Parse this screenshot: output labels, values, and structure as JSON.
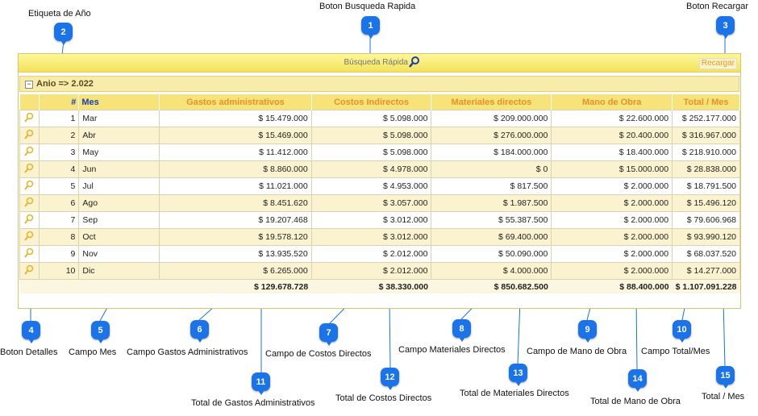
{
  "annotations": {
    "n1": {
      "num": "1",
      "label": "Boton Busqueda Rapida"
    },
    "n2": {
      "num": "2",
      "label": "Etiqueta de Año"
    },
    "n3": {
      "num": "3",
      "label": "Boton Recargar"
    },
    "n4": {
      "num": "4",
      "label": "Boton Detalles"
    },
    "n5": {
      "num": "5",
      "label": "Campo Mes"
    },
    "n6": {
      "num": "6",
      "label": "Campo Gastos Administrativos"
    },
    "n7": {
      "num": "7",
      "label": "Campo de Costos Directos"
    },
    "n8": {
      "num": "8",
      "label": "Campo Materiales Directos"
    },
    "n9": {
      "num": "9",
      "label": "Campo de Mano de Obra"
    },
    "n10": {
      "num": "10",
      "label": "Campo Total/Mes"
    },
    "n11": {
      "num": "11",
      "label": "Total de Gastos Administrativos"
    },
    "n12": {
      "num": "12",
      "label": "Total de Costos Directos"
    },
    "n13": {
      "num": "13",
      "label": "Total de Materiales Directos"
    },
    "n14": {
      "num": "14",
      "label": "Total de Mano de Obra"
    },
    "n15": {
      "num": "15",
      "label": "Total / Mes"
    }
  },
  "toolbar": {
    "search_placeholder": "Búsqueda Rápida",
    "reload_label": "Recargar",
    "search_icon": "magnifier-icon"
  },
  "group": {
    "toggle": "−",
    "label": "Anio => 2.022"
  },
  "columns": {
    "num": "#",
    "mes": "Mes",
    "gastos": "Gastos administrativos",
    "costos": "Costos Indirectos",
    "materiales": "Materiales directos",
    "mano": "Mano de Obra",
    "total": "Total / Mes"
  },
  "rows": [
    {
      "num": "1",
      "mes": "Mar",
      "gastos": "$ 15.479.000",
      "costos": "$ 5.098.000",
      "materiales": "$ 209.000.000",
      "mano": "$ 22.600.000",
      "total": "$ 252.177.000"
    },
    {
      "num": "2",
      "mes": "Abr",
      "gastos": "$ 15.469.000",
      "costos": "$ 5.098.000",
      "materiales": "$ 276.000.000",
      "mano": "$ 20.400.000",
      "total": "$ 316.967.000"
    },
    {
      "num": "3",
      "mes": "May",
      "gastos": "$ 11.412.000",
      "costos": "$ 5.098.000",
      "materiales": "$ 184.000.000",
      "mano": "$ 18.400.000",
      "total": "$ 218.910.000"
    },
    {
      "num": "4",
      "mes": "Jun",
      "gastos": "$ 8.860.000",
      "costos": "$ 4.978.000",
      "materiales": "$ 0",
      "mano": "$ 15.000.000",
      "total": "$ 28.838.000"
    },
    {
      "num": "5",
      "mes": "Jul",
      "gastos": "$ 11.021.000",
      "costos": "$ 4.953.000",
      "materiales": "$ 817.500",
      "mano": "$ 2.000.000",
      "total": "$ 18.791.500"
    },
    {
      "num": "6",
      "mes": "Ago",
      "gastos": "$ 8.451.620",
      "costos": "$ 3.057.000",
      "materiales": "$ 1.987.500",
      "mano": "$ 2.000.000",
      "total": "$ 15.496.120"
    },
    {
      "num": "7",
      "mes": "Sep",
      "gastos": "$ 19.207.468",
      "costos": "$ 3.012.000",
      "materiales": "$ 55.387.500",
      "mano": "$ 2.000.000",
      "total": "$ 79.606.968"
    },
    {
      "num": "8",
      "mes": "Oct",
      "gastos": "$ 19.578.120",
      "costos": "$ 3.012.000",
      "materiales": "$ 69.400.000",
      "mano": "$ 2.000.000",
      "total": "$ 93.990.120"
    },
    {
      "num": "9",
      "mes": "Nov",
      "gastos": "$ 13.935.520",
      "costos": "$ 2.012.000",
      "materiales": "$ 50.090.000",
      "mano": "$ 2.000.000",
      "total": "$ 68.037.520"
    },
    {
      "num": "10",
      "mes": "Dic",
      "gastos": "$ 6.265.000",
      "costos": "$ 2.012.000",
      "materiales": "$ 4.000.000",
      "mano": "$ 2.000.000",
      "total": "$ 14.277.000"
    }
  ],
  "totals": {
    "gastos": "$ 129.678.728",
    "costos": "$ 38.330.000",
    "materiales": "$ 850.682.500",
    "mano": "$ 88.400.000",
    "total": "$ 1.107.091.228"
  },
  "colors": {
    "badge": "#1a73e8",
    "header_bg": "#f6e47a",
    "header_text": "#e8912a",
    "row_alt": "#fbf3cf"
  }
}
